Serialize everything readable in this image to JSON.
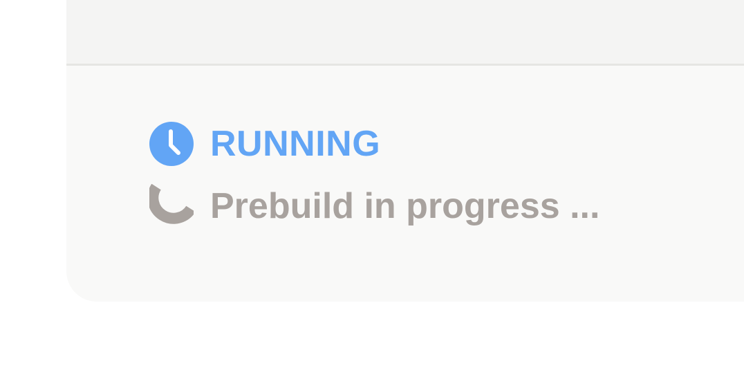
{
  "status": {
    "label": "RUNNING",
    "icon": "clock-icon",
    "color": "#62a5f5"
  },
  "progress": {
    "message": "Prebuild in progress ...",
    "icon": "spinner-icon",
    "color": "#a8a29e"
  },
  "colors": {
    "card_background": "#f9f9f8",
    "header_background": "#f4f4f3",
    "divider": "#e5e5e3"
  }
}
